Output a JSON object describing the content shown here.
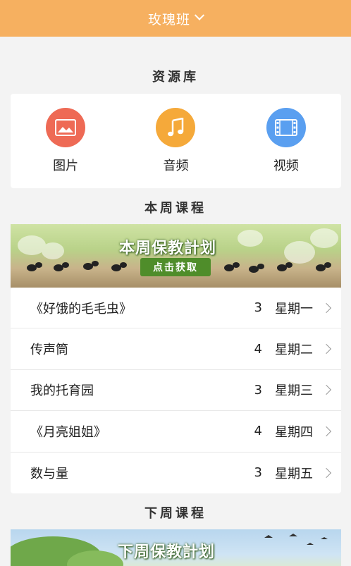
{
  "header": {
    "title": "玫瑰班"
  },
  "resources": {
    "title": "资源库",
    "items": [
      {
        "label": "图片",
        "icon": "image-icon",
        "color": "#ee6a55"
      },
      {
        "label": "音频",
        "icon": "music-note-icon",
        "color": "#f5a93a"
      },
      {
        "label": "视频",
        "icon": "film-icon",
        "color": "#5a9ff0"
      }
    ]
  },
  "this_week": {
    "title": "本周课程",
    "banner_title": "本周保教計划",
    "banner_button": "点击获取",
    "courses": [
      {
        "name": "《好饿的毛毛虫》",
        "count": "3",
        "day": "星期一"
      },
      {
        "name": "传声筒",
        "count": "4",
        "day": "星期二"
      },
      {
        "name": "我的托育园",
        "count": "3",
        "day": "星期三"
      },
      {
        "name": "《月亮姐姐》",
        "count": "4",
        "day": "星期四"
      },
      {
        "name": "数与量",
        "count": "3",
        "day": "星期五"
      }
    ]
  },
  "next_week": {
    "title": "下周课程",
    "banner_title": "下周保教計划"
  }
}
